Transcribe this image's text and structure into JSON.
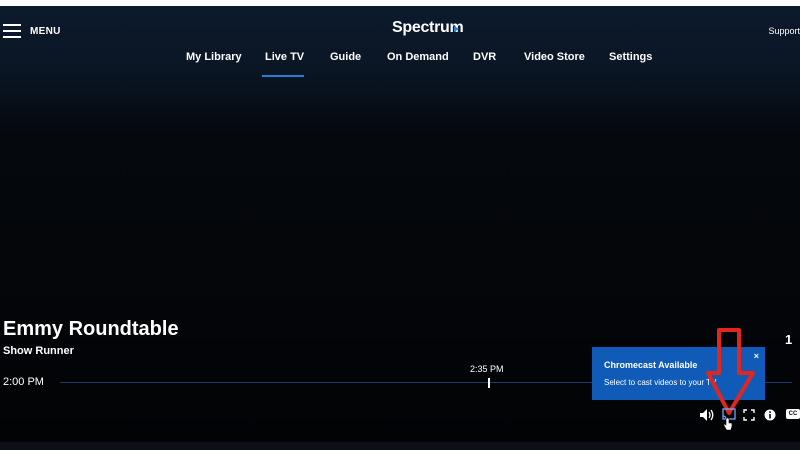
{
  "header": {
    "menu_label": "MENU",
    "logo_text": "Spectrum",
    "support_label": "Support"
  },
  "nav": {
    "items": [
      {
        "label": "My Library"
      },
      {
        "label": "Live TV",
        "active": true
      },
      {
        "label": "Guide"
      },
      {
        "label": "On Demand"
      },
      {
        "label": "DVR"
      },
      {
        "label": "Video Store"
      },
      {
        "label": "Settings"
      }
    ]
  },
  "player": {
    "title": "Emmy Roundtable",
    "subtitle": "Show Runner",
    "start_time": "2:00 PM",
    "current_time": "2:35 PM",
    "channel_badge": "1"
  },
  "chromecast_popup": {
    "title": "Chromecast Available",
    "text": "Select to cast videos to your TV",
    "close": "×"
  },
  "controls": {
    "icons": [
      "volume-icon",
      "cast-icon",
      "fullscreen-icon",
      "info-icon",
      "closed-captions-icon"
    ],
    "cc_label": "CC"
  },
  "colors": {
    "accent": "#2a7dd6",
    "popup_bg": "#0f5bb7",
    "annotation_red": "#e0261f"
  }
}
